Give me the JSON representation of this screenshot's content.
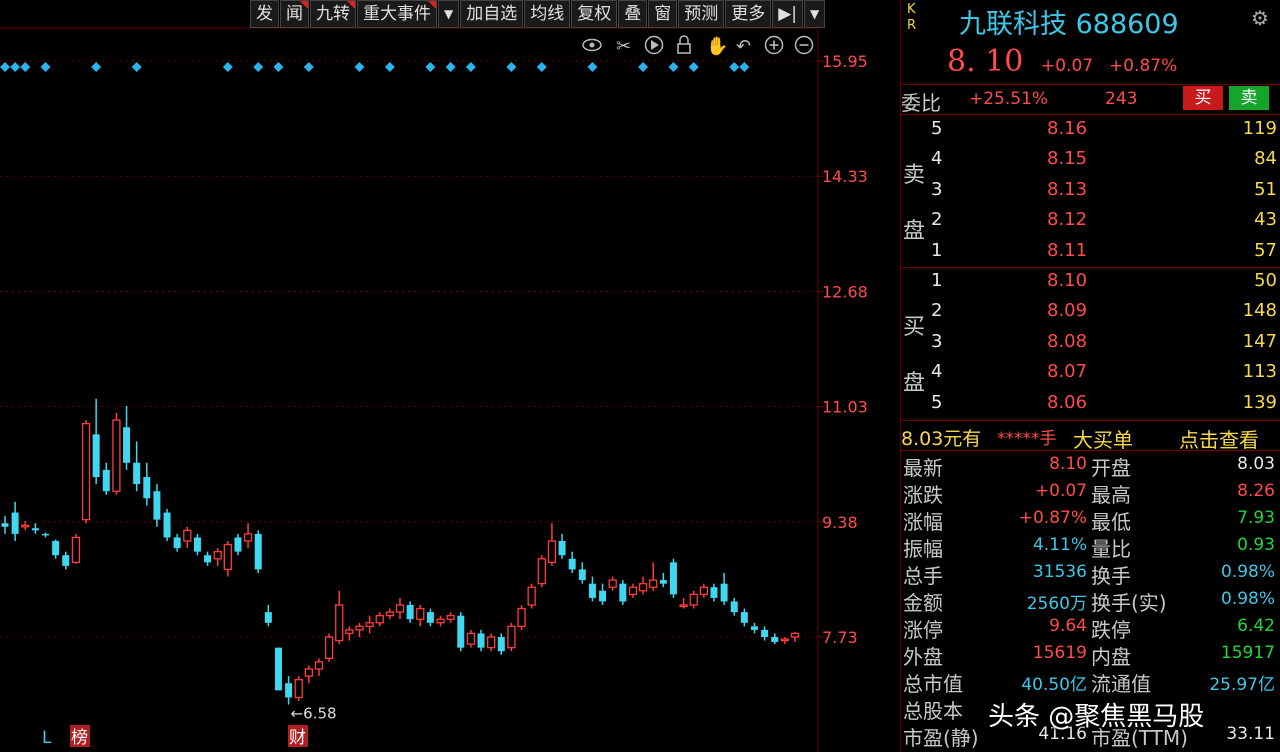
{
  "toolbar": {
    "buttons": [
      "发",
      "闻",
      "九转",
      "重大事件",
      "▼",
      "加自选",
      "均线",
      "复权",
      "叠",
      "窗",
      "预测",
      "更多",
      "▶|",
      "▼"
    ]
  },
  "chart_icons": [
    "eye-icon",
    "scissors-icon",
    "play-icon",
    "lock-icon",
    "hand-icon",
    "undo-icon",
    "zoom-in-icon",
    "zoom-out-icon"
  ],
  "chart_data": {
    "type": "candlestick",
    "y_ticks": [
      "15.95",
      "14.33",
      "12.68",
      "11.03",
      "9.38",
      "7.73"
    ],
    "low_annotation": "←6.58",
    "bottom_markers": [
      "L",
      "榜",
      "财"
    ],
    "ylim": [
      6.3,
      16.3
    ],
    "candles": [
      [
        9.45,
        9.55,
        9.3,
        9.4
      ],
      [
        9.6,
        9.75,
        9.2,
        9.3
      ],
      [
        9.4,
        9.48,
        9.35,
        9.42
      ],
      [
        9.38,
        9.45,
        9.3,
        9.35
      ],
      [
        9.3,
        9.32,
        9.25,
        9.28
      ],
      [
        9.2,
        9.22,
        8.95,
        9.0
      ],
      [
        9.0,
        9.05,
        8.8,
        8.85
      ],
      [
        8.9,
        9.3,
        8.88,
        9.25
      ],
      [
        9.5,
        10.9,
        9.45,
        10.85
      ],
      [
        10.7,
        11.2,
        10.0,
        10.1
      ],
      [
        10.2,
        10.3,
        9.85,
        9.9
      ],
      [
        9.9,
        11.0,
        9.85,
        10.9
      ],
      [
        10.8,
        11.1,
        10.2,
        10.3
      ],
      [
        10.3,
        10.6,
        9.9,
        10.0
      ],
      [
        10.1,
        10.3,
        9.7,
        9.8
      ],
      [
        9.9,
        10.0,
        9.4,
        9.5
      ],
      [
        9.6,
        9.65,
        9.2,
        9.25
      ],
      [
        9.25,
        9.3,
        9.05,
        9.1
      ],
      [
        9.2,
        9.4,
        9.1,
        9.35
      ],
      [
        9.25,
        9.3,
        9.0,
        9.05
      ],
      [
        9.0,
        9.05,
        8.85,
        8.9
      ],
      [
        8.95,
        9.1,
        8.85,
        9.05
      ],
      [
        8.8,
        9.2,
        8.7,
        9.15
      ],
      [
        9.25,
        9.3,
        9.0,
        9.05
      ],
      [
        9.2,
        9.45,
        9.1,
        9.3
      ],
      [
        9.3,
        9.35,
        8.75,
        8.8
      ],
      [
        8.2,
        8.3,
        8.0,
        8.05
      ],
      [
        7.7,
        7.7,
        7.1,
        7.1
      ],
      [
        7.2,
        7.3,
        6.9,
        7.0
      ],
      [
        7.0,
        7.3,
        6.95,
        7.25
      ],
      [
        7.3,
        7.45,
        7.2,
        7.4
      ],
      [
        7.4,
        7.55,
        7.3,
        7.5
      ],
      [
        7.55,
        7.9,
        7.5,
        7.85
      ],
      [
        7.8,
        8.5,
        7.75,
        8.3
      ],
      [
        7.9,
        8.0,
        7.8,
        7.95
      ],
      [
        7.95,
        8.05,
        7.85,
        8.0
      ],
      [
        8.0,
        8.15,
        7.9,
        8.05
      ],
      [
        8.05,
        8.2,
        8.0,
        8.15
      ],
      [
        8.15,
        8.25,
        8.1,
        8.2
      ],
      [
        8.2,
        8.4,
        8.1,
        8.3
      ],
      [
        8.3,
        8.35,
        8.05,
        8.1
      ],
      [
        8.1,
        8.3,
        8.0,
        8.25
      ],
      [
        8.2,
        8.25,
        8.0,
        8.05
      ],
      [
        8.05,
        8.15,
        8.0,
        8.1
      ],
      [
        8.1,
        8.2,
        8.05,
        8.15
      ],
      [
        8.15,
        8.2,
        7.65,
        7.7
      ],
      [
        7.75,
        7.95,
        7.7,
        7.9
      ],
      [
        7.9,
        7.95,
        7.65,
        7.7
      ],
      [
        7.7,
        7.9,
        7.65,
        7.85
      ],
      [
        7.85,
        7.9,
        7.6,
        7.65
      ],
      [
        7.7,
        8.05,
        7.65,
        8.0
      ],
      [
        8.0,
        8.3,
        7.95,
        8.25
      ],
      [
        8.3,
        8.6,
        8.25,
        8.55
      ],
      [
        8.6,
        9.0,
        8.55,
        8.95
      ],
      [
        8.9,
        9.45,
        8.85,
        9.2
      ],
      [
        9.2,
        9.3,
        8.95,
        9.0
      ],
      [
        8.95,
        9.05,
        8.75,
        8.8
      ],
      [
        8.8,
        8.9,
        8.6,
        8.65
      ],
      [
        8.6,
        8.7,
        8.35,
        8.4
      ],
      [
        8.5,
        8.6,
        8.3,
        8.35
      ],
      [
        8.55,
        8.7,
        8.5,
        8.65
      ],
      [
        8.6,
        8.65,
        8.3,
        8.35
      ],
      [
        8.45,
        8.6,
        8.4,
        8.55
      ],
      [
        8.5,
        8.7,
        8.45,
        8.6
      ],
      [
        8.55,
        8.9,
        8.5,
        8.65
      ],
      [
        8.65,
        8.75,
        8.55,
        8.6
      ],
      [
        8.9,
        8.95,
        8.4,
        8.45
      ],
      [
        8.3,
        8.4,
        8.25,
        8.3
      ],
      [
        8.3,
        8.5,
        8.25,
        8.45
      ],
      [
        8.45,
        8.6,
        8.4,
        8.55
      ],
      [
        8.55,
        8.6,
        8.35,
        8.4
      ],
      [
        8.6,
        8.75,
        8.3,
        8.35
      ],
      [
        8.35,
        8.4,
        8.15,
        8.2
      ],
      [
        8.2,
        8.25,
        8.0,
        8.05
      ],
      [
        8.0,
        8.05,
        7.9,
        7.95
      ],
      [
        7.95,
        8.0,
        7.8,
        7.85
      ],
      [
        7.85,
        7.9,
        7.75,
        7.78
      ],
      [
        7.8,
        7.85,
        7.75,
        7.82
      ],
      [
        7.85,
        7.92,
        7.78,
        7.9
      ]
    ],
    "event_marker_indices": [
      0,
      1,
      2,
      4,
      9,
      13,
      22,
      25,
      27,
      30,
      35,
      38,
      42,
      44,
      46,
      50,
      53,
      58,
      63,
      66,
      68,
      72,
      73
    ]
  },
  "quote": {
    "kr_label_k": "K",
    "kr_label_r": "R",
    "name_code": "九联科技 688609",
    "price": "8. 10",
    "change": "+0.07",
    "change_pct": "+0.87%",
    "weibi_label": "委比",
    "weibi_value": "+25.51%",
    "weicha_value": "243",
    "buy_label": "买",
    "sell_label": "卖"
  },
  "sell_side_label": [
    "卖",
    "盘"
  ],
  "buy_side_label": [
    "买",
    "盘"
  ],
  "asks": [
    {
      "level": "5",
      "price": "8.16",
      "vol": "119"
    },
    {
      "level": "4",
      "price": "8.15",
      "vol": "84"
    },
    {
      "level": "3",
      "price": "8.13",
      "vol": "51"
    },
    {
      "level": "2",
      "price": "8.12",
      "vol": "43"
    },
    {
      "level": "1",
      "price": "8.11",
      "vol": "57"
    }
  ],
  "bids": [
    {
      "level": "1",
      "price": "8.10",
      "vol": "50"
    },
    {
      "level": "2",
      "price": "8.09",
      "vol": "148"
    },
    {
      "level": "3",
      "price": "8.08",
      "vol": "147"
    },
    {
      "level": "4",
      "price": "8.07",
      "vol": "113"
    },
    {
      "level": "5",
      "price": "8.06",
      "vol": "139"
    }
  ],
  "big_order": {
    "price_text": "8.03元有",
    "stars": "*****手",
    "label": "大买单",
    "link": "点击查看"
  },
  "stats": [
    {
      "l1": "最新",
      "v1": "8.10",
      "c1": "red",
      "l2": "开盘",
      "v2": "8.03",
      "c2": "white"
    },
    {
      "l1": "涨跌",
      "v1": "+0.07",
      "c1": "red",
      "l2": "最高",
      "v2": "8.26",
      "c2": "red"
    },
    {
      "l1": "涨幅",
      "v1": "+0.87%",
      "c1": "red",
      "l2": "最低",
      "v2": "7.93",
      "c2": "green"
    },
    {
      "l1": "振幅",
      "v1": "4.11%",
      "c1": "cyan",
      "l2": "量比",
      "v2": "0.93",
      "c2": "green"
    },
    {
      "l1": "总手",
      "v1": "31536",
      "c1": "cyan",
      "l2": "换手",
      "v2": "0.98%",
      "c2": "cyan"
    },
    {
      "l1": "金额",
      "v1": "2560万",
      "c1": "cyan",
      "l2": "换手(实)",
      "v2": "0.98%",
      "c2": "cyan"
    },
    {
      "l1": "涨停",
      "v1": "9.64",
      "c1": "red",
      "l2": "跌停",
      "v2": "6.42",
      "c2": "green"
    },
    {
      "l1": "外盘",
      "v1": "15619",
      "c1": "red",
      "l2": "内盘",
      "v2": "15917",
      "c2": "green"
    },
    {
      "l1": "总市值",
      "v1": "40.50亿",
      "c1": "cyan",
      "l2": "流通值",
      "v2": "25.97亿",
      "c2": "cyan"
    },
    {
      "l1": "总股本",
      "v1": "",
      "c1": "cyan",
      "l2": "",
      "v2": "",
      "c2": "cyan"
    },
    {
      "l1": "市盈(静)",
      "v1": "41.16",
      "c1": "white",
      "l2": "市盈(TTM)",
      "v2": "33.11",
      "c2": "white"
    }
  ],
  "watermark": "头条 @聚焦黑马股",
  "colors": {
    "up": "#ff3b3b",
    "down": "#3fd8f0",
    "marker": "#2bb3f0",
    "grid": "#6a0000"
  }
}
